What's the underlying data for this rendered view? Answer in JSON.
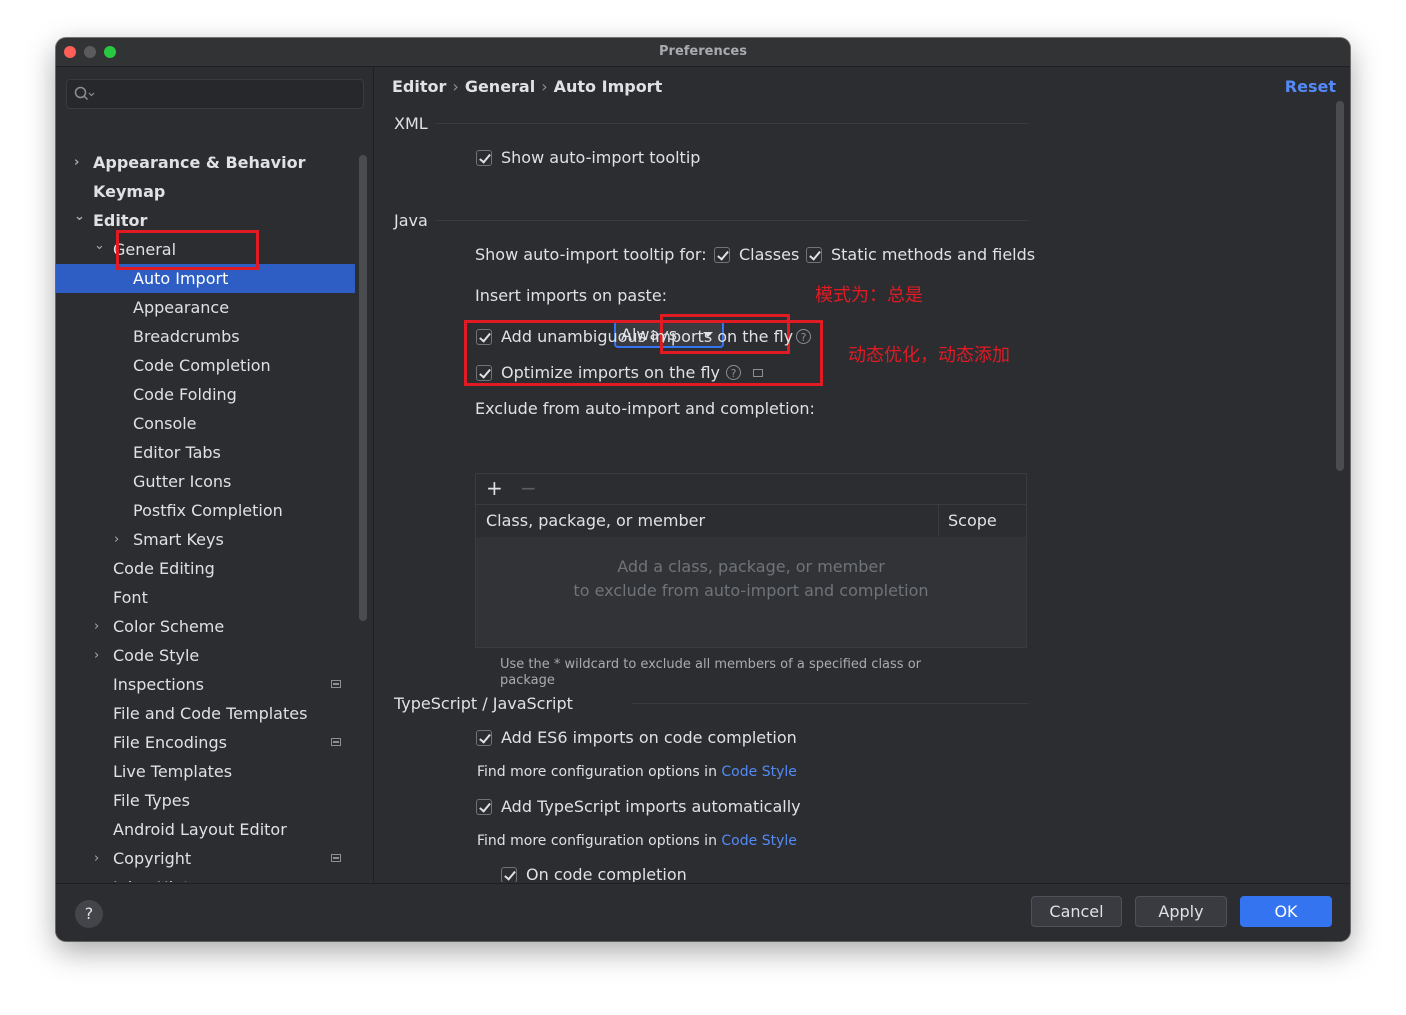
{
  "window": {
    "title": "Preferences"
  },
  "sidebar": {
    "search_placeholder": "",
    "items": [
      {
        "label": "Appearance & Behavior",
        "arrow": "›",
        "bold": true
      },
      {
        "label": "Keymap",
        "bold": true
      },
      {
        "label": "Editor",
        "arrow": "⌄",
        "bold": true
      },
      {
        "label": "General",
        "arrow": "⌄"
      },
      {
        "label": "Auto Import",
        "selected": true
      },
      {
        "label": "Appearance"
      },
      {
        "label": "Breadcrumbs"
      },
      {
        "label": "Code Completion"
      },
      {
        "label": "Code Folding"
      },
      {
        "label": "Console"
      },
      {
        "label": "Editor Tabs"
      },
      {
        "label": "Gutter Icons"
      },
      {
        "label": "Postfix Completion"
      },
      {
        "label": "Smart Keys",
        "arrow": "›"
      },
      {
        "label": "Code Editing"
      },
      {
        "label": "Font"
      },
      {
        "label": "Color Scheme",
        "arrow": "›"
      },
      {
        "label": "Code Style",
        "arrow": "›"
      },
      {
        "label": "Inspections",
        "project": true
      },
      {
        "label": "File and Code Templates"
      },
      {
        "label": "File Encodings",
        "project": true
      },
      {
        "label": "Live Templates"
      },
      {
        "label": "File Types"
      },
      {
        "label": "Android Layout Editor"
      },
      {
        "label": "Copyright",
        "arrow": "›",
        "project": true
      },
      {
        "label": "Inlay Hints",
        "arrow": "›",
        "project": true
      }
    ]
  },
  "breadcrumb": [
    "Editor",
    "General",
    "Auto Import"
  ],
  "reset_label": "Reset",
  "xml": {
    "title": "XML",
    "show_tooltip": {
      "label": "Show auto-import tooltip",
      "checked": true
    }
  },
  "java": {
    "title": "Java",
    "tooltip_for_label": "Show auto-import tooltip for:",
    "classes": {
      "label": "Classes",
      "checked": true
    },
    "static_methods": {
      "label": "Static methods and fields",
      "checked": true
    },
    "insert_on_paste_label": "Insert imports on paste:",
    "insert_on_paste_value": "Always",
    "add_unambiguous": {
      "label": "Add unambiguous imports on the fly",
      "checked": true
    },
    "optimize": {
      "label": "Optimize imports on the fly",
      "checked": true
    },
    "exclude_label": "Exclude from auto-import and completion:",
    "table": {
      "add_icon": "+",
      "remove_icon": "−",
      "columns": [
        "Class, package, or member",
        "Scope"
      ],
      "empty_line1": "Add a class, package, or member",
      "empty_line2": "to exclude from auto-import and completion"
    },
    "wildcard_hint": "Use the * wildcard to exclude all members of a specified class or package"
  },
  "ts": {
    "title": "TypeScript / JavaScript",
    "es6": {
      "label": "Add ES6 imports on code completion",
      "checked": true
    },
    "find_more_prefix": "Find more configuration options in",
    "code_style_link": "Code Style",
    "ts_auto": {
      "label": "Add TypeScript imports automatically",
      "checked": true
    },
    "on_completion": {
      "label": "On code completion",
      "checked": true
    }
  },
  "annotations": {
    "mode": "模式为：总是",
    "dynamic": "动态优化，动态添加"
  },
  "footer": {
    "help": "?",
    "cancel": "Cancel",
    "apply": "Apply",
    "ok": "OK"
  },
  "colors": {
    "accent": "#3574f0",
    "selection": "#2e5ec4",
    "link": "#548af7",
    "annotation_red": "#e01b24",
    "background": "#2b2d30"
  }
}
